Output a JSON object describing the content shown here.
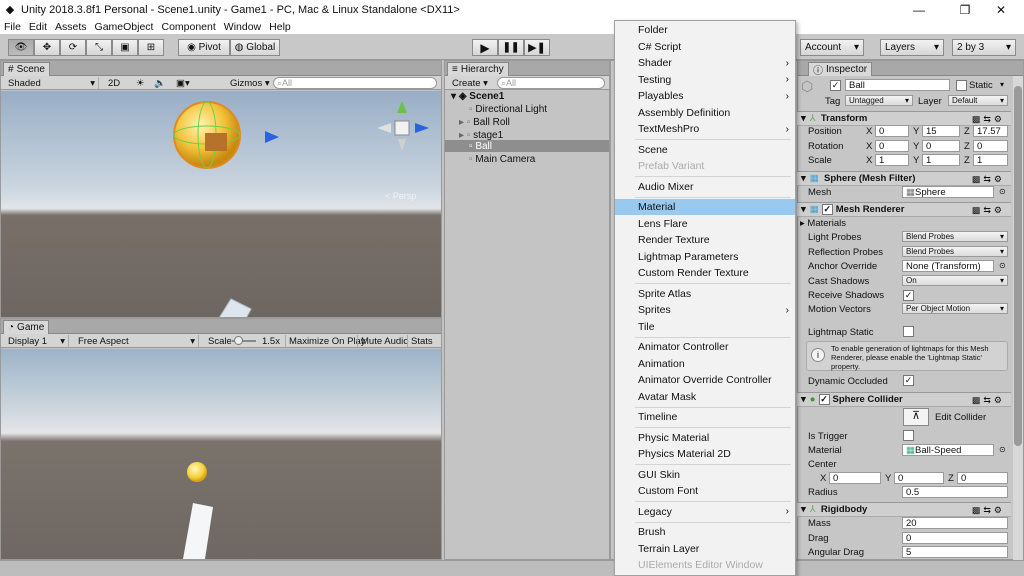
{
  "window": {
    "title": "Unity 2018.3.8f1 Personal - Scene1.unity - Game1 - PC, Mac & Linux Standalone <DX11>",
    "minimize": "—",
    "maximize": "❐",
    "close": "✕"
  },
  "menubar": [
    "File",
    "Edit",
    "Assets",
    "GameObject",
    "Component",
    "Window",
    "Help"
  ],
  "toolbar": {
    "pivot": "Pivot",
    "global": "Global",
    "account": "Account",
    "layers": "Layers",
    "layout": "2 by 3"
  },
  "scene": {
    "tab": "Scene",
    "shading": "Shaded",
    "mode2d": "2D",
    "gizmos": "Gizmos",
    "search_placeholder": "All",
    "persp_label": "< Persp"
  },
  "game": {
    "tab": "Game",
    "display": "Display 1",
    "aspect": "Free Aspect",
    "scale_label": "Scale",
    "scale_value": "1.5x",
    "maximize": "Maximize On Play",
    "mute": "Mute Audio",
    "stats": "Stats"
  },
  "hierarchy": {
    "tab": "Hierarchy",
    "create": "Create",
    "search_placeholder": "All",
    "scene": "Scene1",
    "items": [
      "Directional Light",
      "Ball Roll",
      "stage1",
      "Ball",
      "Main Camera"
    ],
    "selected": "Ball"
  },
  "menu": {
    "items": [
      {
        "label": "Folder"
      },
      {
        "label": "C# Script"
      },
      {
        "label": "Shader",
        "sub": true
      },
      {
        "label": "Testing",
        "sub": true
      },
      {
        "label": "Playables",
        "sub": true
      },
      {
        "label": "Assembly Definition"
      },
      {
        "label": "TextMeshPro",
        "sub": true
      },
      {
        "label": "Scene"
      },
      {
        "label": "Prefab Variant",
        "disabled": true
      },
      {
        "label": "Audio Mixer"
      },
      {
        "label": "Material",
        "selected": true
      },
      {
        "label": "Lens Flare"
      },
      {
        "label": "Render Texture"
      },
      {
        "label": "Lightmap Parameters"
      },
      {
        "label": "Custom Render Texture"
      },
      {
        "label": "Sprite Atlas"
      },
      {
        "label": "Sprites",
        "sub": true
      },
      {
        "label": "Tile"
      },
      {
        "label": "Animator Controller"
      },
      {
        "label": "Animation"
      },
      {
        "label": "Animator Override Controller"
      },
      {
        "label": "Avatar Mask"
      },
      {
        "label": "Timeline"
      },
      {
        "label": "Physic Material"
      },
      {
        "label": "Physics Material 2D"
      },
      {
        "label": "GUI Skin"
      },
      {
        "label": "Custom Font"
      },
      {
        "label": "Legacy",
        "sub": true
      },
      {
        "label": "Brush"
      },
      {
        "label": "Terrain Layer"
      },
      {
        "label": "UIElements Editor Window",
        "disabled": true
      }
    ]
  },
  "inspector": {
    "tab": "Inspector",
    "name": "Ball",
    "static": "Static",
    "tag_label": "Tag",
    "tag": "Untagged",
    "layer_label": "Layer",
    "layer": "Default",
    "transform": {
      "title": "Transform",
      "position": {
        "label": "Position",
        "x": "0",
        "y": "15",
        "z": "17.57"
      },
      "rotation": {
        "label": "Rotation",
        "x": "0",
        "y": "0",
        "z": "0"
      },
      "scale": {
        "label": "Scale",
        "x": "1",
        "y": "1",
        "z": "1"
      }
    },
    "meshfilter": {
      "title": "Sphere (Mesh Filter)",
      "mesh_label": "Mesh",
      "mesh": "Sphere"
    },
    "meshrenderer": {
      "title": "Mesh Renderer",
      "materials": "Materials",
      "light_probes_label": "Light Probes",
      "light_probes": "Blend Probes",
      "reflection_label": "Reflection Probes",
      "reflection": "Blend Probes",
      "anchor_label": "Anchor Override",
      "anchor": "None (Transform)",
      "cast_label": "Cast Shadows",
      "cast": "On",
      "receive_label": "Receive Shadows",
      "motion_label": "Motion Vectors",
      "motion": "Per Object Motion",
      "lightmap_label": "Lightmap Static",
      "info": "To enable generation of lightmaps for this Mesh Renderer, please enable the 'Lightmap Static' property.",
      "occluded_label": "Dynamic Occluded"
    },
    "collider": {
      "title": "Sphere Collider",
      "edit": "Edit Collider",
      "trigger_label": "Is Trigger",
      "material_label": "Material",
      "material": "Ball-Speed",
      "center_label": "Center",
      "cx": "0",
      "cy": "0",
      "cz": "0",
      "radius_label": "Radius",
      "radius": "0.5"
    },
    "rigidbody": {
      "title": "Rigidbody",
      "mass_label": "Mass",
      "mass": "20",
      "drag_label": "Drag",
      "drag": "0",
      "ang_label": "Angular Drag",
      "ang": "5"
    }
  },
  "axis_labels": {
    "x": "X",
    "y": "Y",
    "z": "Z"
  }
}
